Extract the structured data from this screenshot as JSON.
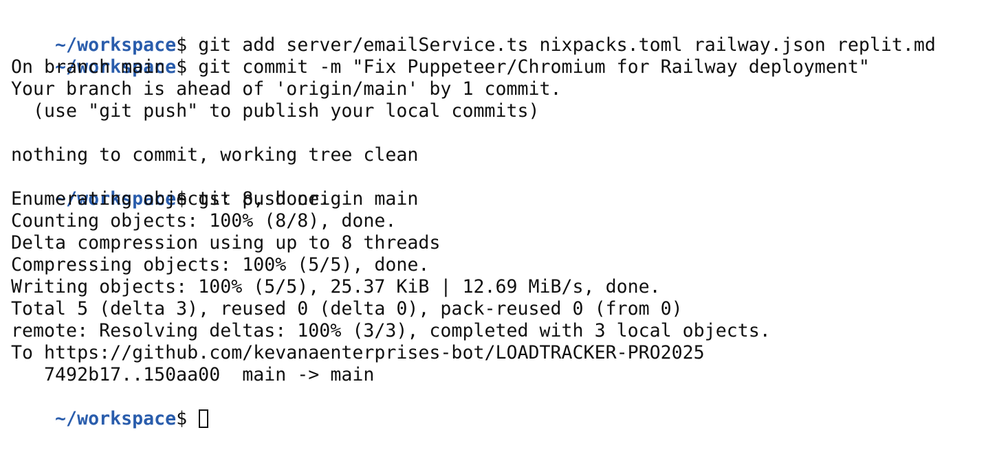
{
  "terminal": {
    "prompt_path": "~/workspace",
    "prompt_symbol": "$ ",
    "commands": {
      "add": "git add server/emailService.ts nixpacks.toml railway.json replit.md",
      "commit": "git commit -m \"Fix Puppeteer/Chromium for Railway deployment\"",
      "push": "git push origin main"
    },
    "commit_output": [
      "On branch main",
      "Your branch is ahead of 'origin/main' by 1 commit.",
      "  (use \"git push\" to publish your local commits)",
      "",
      "nothing to commit, working tree clean"
    ],
    "push_output": [
      "Enumerating objects: 8, done.",
      "Counting objects: 100% (8/8), done.",
      "Delta compression using up to 8 threads",
      "Compressing objects: 100% (5/5), done.",
      "Writing objects: 100% (5/5), 25.37 KiB | 12.69 MiB/s, done.",
      "Total 5 (delta 3), reused 0 (delta 0), pack-reused 0 (from 0)",
      "remote: Resolving deltas: 100% (3/3), completed with 3 local objects.",
      "To https://github.com/kevanaenterprises-bot/LOADTRACKER-PRO2025",
      "   7492b17..150aa00  main -> main"
    ],
    "colors": {
      "prompt": "#2a5dac",
      "text": "#111111",
      "background": "#ffffff"
    }
  }
}
